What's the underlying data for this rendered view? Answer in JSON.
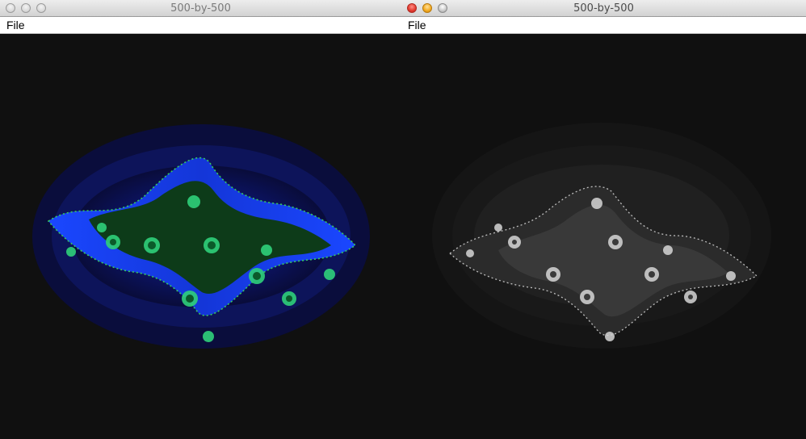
{
  "windows": [
    {
      "title": "500-by-500",
      "menu": [
        "File"
      ],
      "active": false,
      "render_mode": "color-blue-green",
      "colors": {
        "background": "#101010",
        "halo_outer": "#0a0a3a",
        "body": "#1233d8",
        "core": "#0f5a12",
        "edge": "#3dd66a"
      }
    },
    {
      "title": "500-by-500",
      "menu": [
        "File"
      ],
      "active": true,
      "render_mode": "grayscale",
      "colors": {
        "background": "#101010",
        "halo_outer": "#161616",
        "body": "#2c2c2c",
        "core": "#3c3c3c",
        "edge": "#d8d8d8"
      }
    }
  ]
}
